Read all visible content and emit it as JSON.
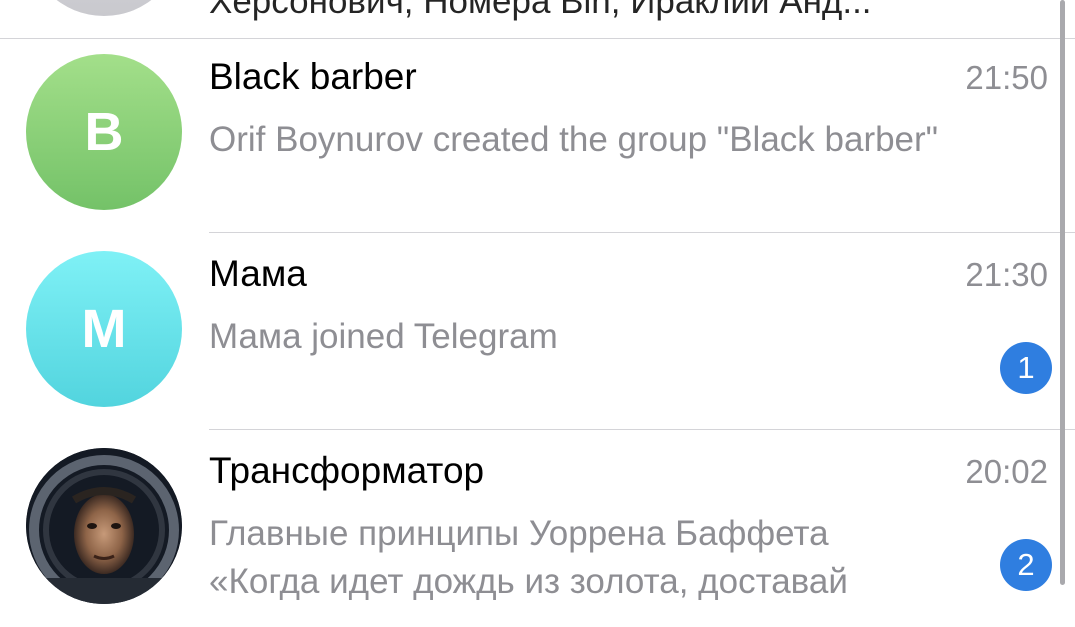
{
  "chats": [
    {
      "title": "",
      "preview": "Херсонович, Номера Bin, Ираклий Анд...",
      "time": "",
      "avatar_letter": "",
      "avatar_colors": [
        "#dcdce0",
        "#c9c9ce"
      ]
    },
    {
      "title": "Black barber",
      "preview": "Orif Boynurov created the group \"Black barber\"",
      "time": "21:50",
      "avatar_letter": "B",
      "avatar_colors": [
        "#a3df8a",
        "#74c268"
      ]
    },
    {
      "title": "Мама",
      "preview": "Мама joined Telegram",
      "time": "21:30",
      "avatar_letter": "M",
      "avatar_colors": [
        "#7ff1f6",
        "#52d4de"
      ],
      "unread": "1"
    },
    {
      "title": "Трансформатор",
      "preview_lines": [
        "Главные принципы Уоррена Баффета",
        "«Когда идет дождь из золота, доставай"
      ],
      "time": "20:02",
      "avatar_icon": "astronaut-portrait",
      "unread": "2"
    }
  ],
  "colors": {
    "badge": "#2f7ee0",
    "secondary_text": "#8e8e93",
    "separator": "#d4d4d8"
  }
}
